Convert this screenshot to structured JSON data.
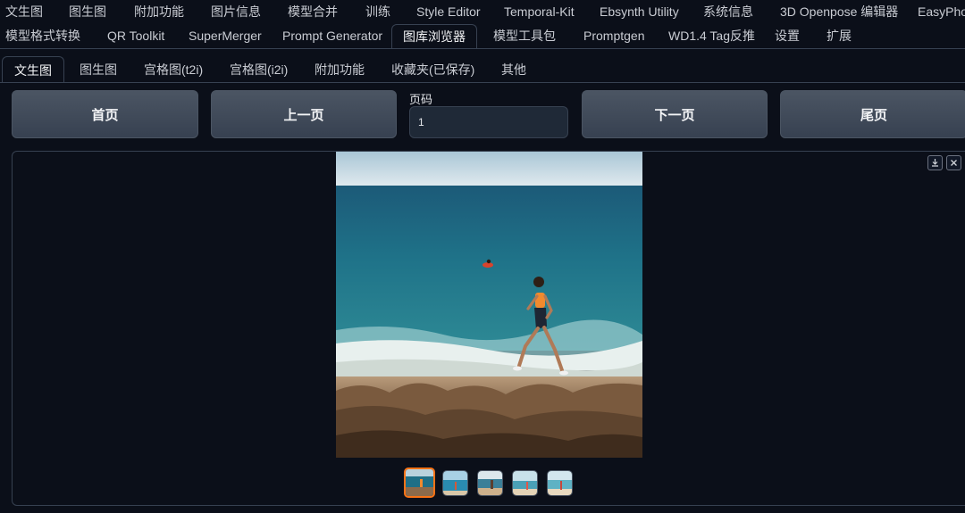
{
  "top_tabs_row1": [
    "文生图",
    "图生图",
    "附加功能",
    "图片信息",
    "模型合并",
    "训练",
    "Style Editor",
    "Temporal-Kit",
    "Ebsynth Utility",
    "系统信息",
    "3D Openpose 编辑器",
    "EasyPhot"
  ],
  "top_tabs_row2": [
    "模型格式转换",
    "QR Toolkit",
    "SuperMerger",
    "Prompt Generator",
    "图库浏览器",
    "模型工具包",
    "Promptgen",
    "WD1.4 Tag反推",
    "设置",
    "扩展"
  ],
  "active_top_tab": "图库浏览器",
  "sub_tabs": [
    "文生图",
    "图生图",
    "宫格图(t2i)",
    "宫格图(i2i)",
    "附加功能",
    "收藏夹(已保存)",
    "其他"
  ],
  "active_sub_tab": "文生图",
  "nav": {
    "first_label": "首页",
    "prev_label": "上一页",
    "page_label": "页码",
    "page_value": "1",
    "next_label": "下一页",
    "last_label": "尾页"
  },
  "gallery": {
    "download_icon": "download-icon",
    "close_icon": "close-icon",
    "thumbnail_count": 5,
    "selected_thumbnail": 1
  },
  "colors": {
    "background": "#0b0f19",
    "button": "#4b5563",
    "selected_border": "#f97316"
  }
}
